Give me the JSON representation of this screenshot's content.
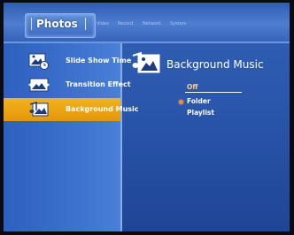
{
  "tabs": {
    "active": "Photos",
    "items": [
      "Video",
      "Record",
      "Network",
      "System"
    ]
  },
  "left_menu": {
    "items": [
      {
        "label": "Slide Show Time",
        "icon": "photo-clock-icon",
        "selected": false
      },
      {
        "label": "Transition Effect",
        "icon": "photo-transition-icon",
        "selected": false
      },
      {
        "label": "Background Music",
        "icon": "photo-music-icon",
        "selected": true
      }
    ]
  },
  "panel": {
    "title": "Background Music",
    "title_icon": "photo-music-icon",
    "options": [
      {
        "label": "Off",
        "highlighted": true
      },
      {
        "label": "Folder",
        "highlighted": false,
        "bullet": true
      },
      {
        "label": "Playlist",
        "highlighted": false
      }
    ]
  },
  "colors": {
    "selection": "#f0a915",
    "background": "#2b58ad",
    "highlight_text": "#ffd26a",
    "bullet": "#ff8a2a"
  }
}
